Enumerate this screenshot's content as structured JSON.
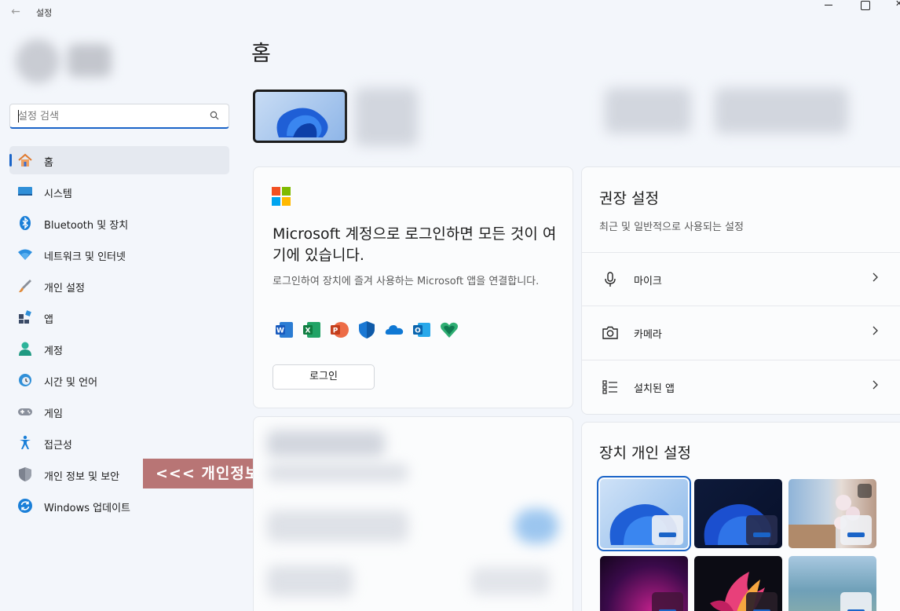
{
  "window": {
    "title": "설정"
  },
  "search": {
    "placeholder": "설정 검색"
  },
  "nav": [
    {
      "label": "홈",
      "icon": "home-icon",
      "active": true
    },
    {
      "label": "시스템",
      "icon": "system-icon"
    },
    {
      "label": "Bluetooth 및 장치",
      "icon": "bluetooth-icon"
    },
    {
      "label": "네트워크 및 인터넷",
      "icon": "wifi-icon"
    },
    {
      "label": "개인 설정",
      "icon": "brush-icon"
    },
    {
      "label": "앱",
      "icon": "apps-icon"
    },
    {
      "label": "계정",
      "icon": "account-icon"
    },
    {
      "label": "시간 및 언어",
      "icon": "globe-clock-icon"
    },
    {
      "label": "게임",
      "icon": "gamepad-icon"
    },
    {
      "label": "접근성",
      "icon": "accessibility-icon"
    },
    {
      "label": "개인 정보 및 보안",
      "icon": "shield-icon"
    },
    {
      "label": "Windows 업데이트",
      "icon": "update-icon"
    }
  ],
  "annotation": "<<< 개인정보 및 보안",
  "main": {
    "title": "홈",
    "signin_card": {
      "title": "Microsoft 계정으로 로그인하면 모든 것이 여기에 있습니다.",
      "description": "로그인하여 장치에 즐겨 사용하는 Microsoft 앱을 연결합니다.",
      "apps": [
        "word-icon",
        "excel-icon",
        "powerpoint-icon",
        "defender-icon",
        "onedrive-icon",
        "outlook-icon",
        "family-icon"
      ],
      "button": "로그인"
    },
    "recommended": {
      "title": "권장 설정",
      "subtitle": "최근 및 일반적으로 사용되는 설정",
      "items": [
        {
          "label": "마이크",
          "icon": "microphone-icon"
        },
        {
          "label": "카메라",
          "icon": "camera-icon"
        },
        {
          "label": "설치된 앱",
          "icon": "installed-apps-icon"
        }
      ]
    },
    "device_personalize": {
      "title": "장치 개인 설정"
    }
  },
  "colors": {
    "accent": "#1a64c8",
    "annotation_bg": "#b87575",
    "background": "#f3f6fb"
  }
}
